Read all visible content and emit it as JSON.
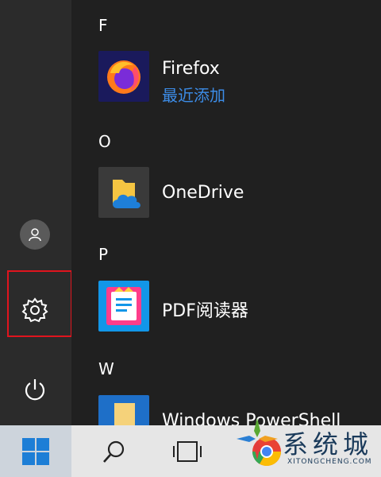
{
  "sections": [
    {
      "letter": "F",
      "app": {
        "name": "Firefox",
        "subtitle": "最近添加",
        "icon": "firefox-icon"
      }
    },
    {
      "letter": "O",
      "app": {
        "name": "OneDrive",
        "icon": "onedrive-icon"
      }
    },
    {
      "letter": "P",
      "app": {
        "name": "PDF阅读器",
        "icon": "pdf-reader-icon"
      }
    },
    {
      "letter": "W",
      "app": {
        "name": "Windows PowerShell",
        "icon": "powershell-folder-icon"
      }
    }
  ],
  "rail": {
    "account": "user-icon",
    "settings": "gear-icon",
    "power": "power-icon"
  },
  "taskbar": {
    "start": "windows-logo-icon",
    "search": "search-icon",
    "task_view": "task-view-icon",
    "chrome": "chrome-icon"
  },
  "watermark": {
    "title": "系统城",
    "domain": "XITONGCHENG.COM"
  },
  "colors": {
    "highlight": "#e0141e",
    "accent_text": "#3c8ce7",
    "start_blue": "#1d7ed6"
  }
}
